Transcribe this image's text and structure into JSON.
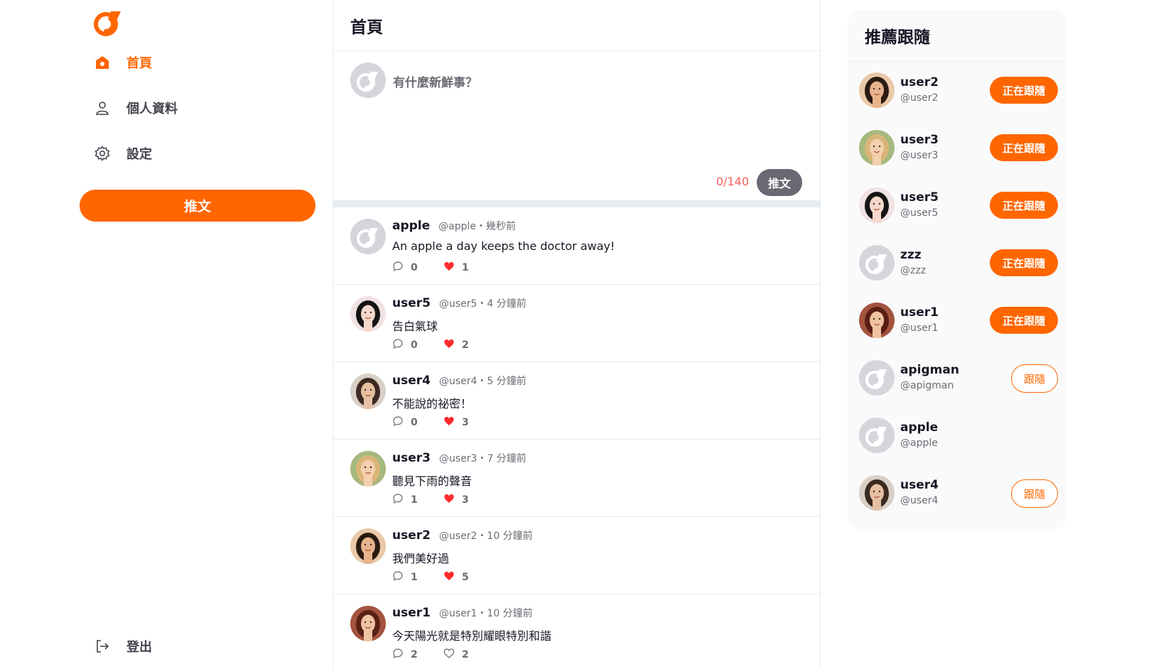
{
  "colors": {
    "brand": "#ff6600",
    "like": "#ff2b2b",
    "border": "#e6ecf0"
  },
  "nav": {
    "home": "首頁",
    "profile": "個人資料",
    "settings": "設定",
    "tweet_button": "推文",
    "logout": "登出"
  },
  "main": {
    "title": "首頁",
    "compose": {
      "placeholder": "有什麼新鮮事？",
      "count": "0/140",
      "button": "推文"
    }
  },
  "tweets": [
    {
      "name": "apple",
      "meta": "@apple・幾秒前",
      "text": "An apple a day keeps the doctor away!",
      "replies": "0",
      "likes": "1",
      "liked": true,
      "avatar": "default"
    },
    {
      "name": "user5",
      "meta": "@user5・4 分鐘前",
      "text": "告白氣球",
      "replies": "0",
      "likes": "2",
      "liked": true,
      "avatar": "user5"
    },
    {
      "name": "user4",
      "meta": "@user4・5 分鐘前",
      "text": "不能說的祕密！",
      "replies": "0",
      "likes": "3",
      "liked": true,
      "avatar": "user4"
    },
    {
      "name": "user3",
      "meta": "@user3・7 分鐘前",
      "text": "聽見下雨的聲音",
      "replies": "1",
      "likes": "3",
      "liked": true,
      "avatar": "user3"
    },
    {
      "name": "user2",
      "meta": "@user2・10 分鐘前",
      "text": "我們美好過",
      "replies": "1",
      "likes": "5",
      "liked": true,
      "avatar": "user2"
    },
    {
      "name": "user1",
      "meta": "@user1・10 分鐘前",
      "text": "今天陽光就是特別耀眼特別和諧",
      "replies": "2",
      "likes": "2",
      "liked": false,
      "avatar": "user1"
    }
  ],
  "recommend": {
    "title": "推薦跟隨",
    "users": [
      {
        "name": "user2",
        "handle": "@user2",
        "button": "正在跟隨",
        "state": "following",
        "avatar": "user2"
      },
      {
        "name": "user3",
        "handle": "@user3",
        "button": "正在跟隨",
        "state": "following",
        "avatar": "user3"
      },
      {
        "name": "user5",
        "handle": "@user5",
        "button": "正在跟隨",
        "state": "following",
        "avatar": "user5"
      },
      {
        "name": "zzz",
        "handle": "@zzz",
        "button": "正在跟隨",
        "state": "following",
        "avatar": "default"
      },
      {
        "name": "user1",
        "handle": "@user1",
        "button": "正在跟隨",
        "state": "following",
        "avatar": "user1"
      },
      {
        "name": "apigman",
        "handle": "@apigman",
        "button": "跟隨",
        "state": "follow",
        "avatar": "default"
      },
      {
        "name": "apple",
        "handle": "@apple",
        "button": "",
        "state": "self",
        "avatar": "default"
      },
      {
        "name": "user4",
        "handle": "@user4",
        "button": "跟隨",
        "state": "follow",
        "avatar": "user4"
      }
    ]
  }
}
